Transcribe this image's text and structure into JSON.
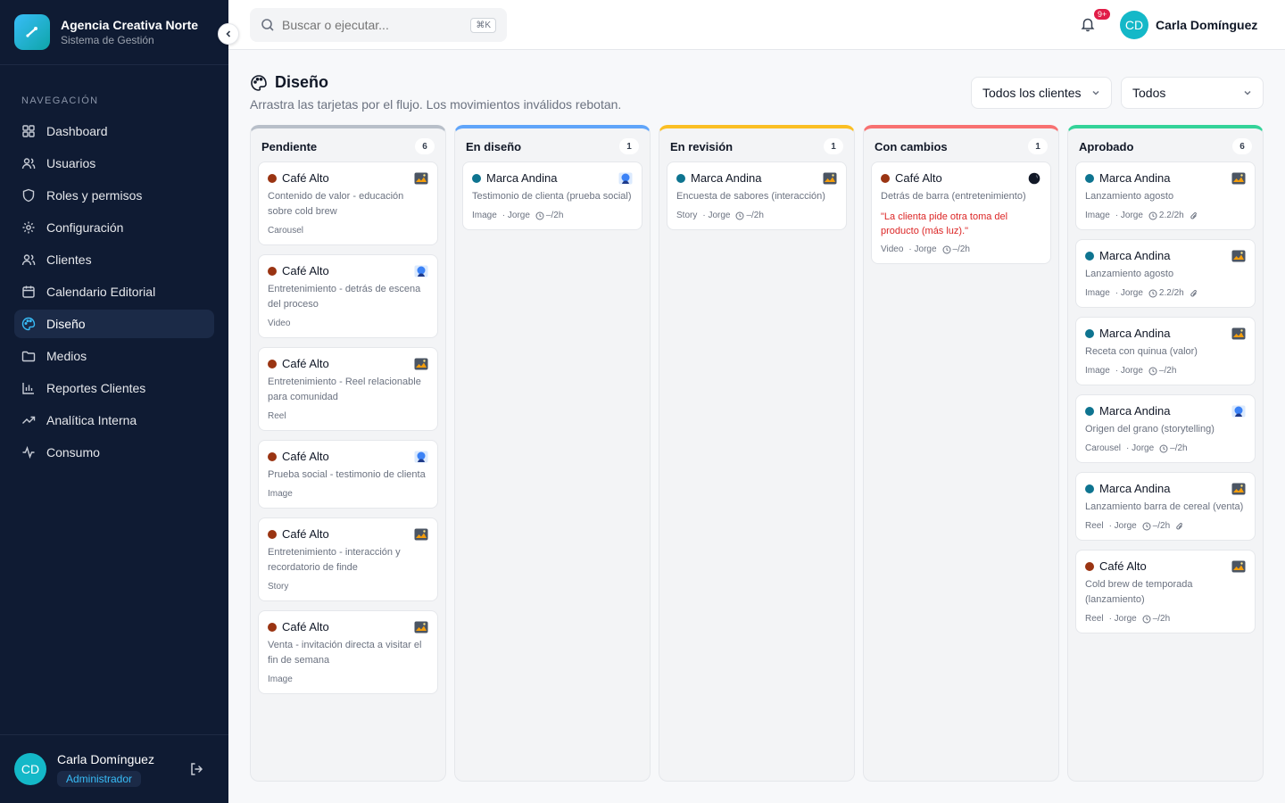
{
  "brand": {
    "title": "Agencia Creativa Norte",
    "subtitle": "Sistema de Gestión"
  },
  "nav": {
    "heading": "NAVEGACIÓN",
    "items": [
      {
        "label": "Dashboard",
        "icon": "grid-icon"
      },
      {
        "label": "Usuarios",
        "icon": "users-icon"
      },
      {
        "label": "Roles y permisos",
        "icon": "shield-icon"
      },
      {
        "label": "Configuración",
        "icon": "gear-icon"
      },
      {
        "label": "Clientes",
        "icon": "users-icon"
      },
      {
        "label": "Calendario Editorial",
        "icon": "calendar-icon"
      },
      {
        "label": "Diseño",
        "icon": "palette-icon",
        "active": true
      },
      {
        "label": "Medios",
        "icon": "folder-icon"
      },
      {
        "label": "Reportes Clientes",
        "icon": "bar-chart-icon"
      },
      {
        "label": "Analítica Interna",
        "icon": "trending-icon"
      },
      {
        "label": "Consumo",
        "icon": "activity-icon"
      }
    ]
  },
  "user": {
    "initials": "CD",
    "name": "Carla Domínguez",
    "role": "Administrador"
  },
  "search": {
    "placeholder": "Buscar o ejecutar...",
    "shortcut": "⌘K"
  },
  "notifications": {
    "badge": "9+"
  },
  "page": {
    "title": "Diseño",
    "description": "Arrastra las tarjetas por el flujo. Los movimientos inválidos rebotan."
  },
  "filters": {
    "clients": "Todos los clientes",
    "status": "Todos"
  },
  "colors": {
    "cafe": "#9a3412",
    "marca": "#0e7490",
    "accent": "#38bdf8"
  },
  "columns": [
    {
      "title": "Pendiente",
      "count": "6",
      "color": "#b8bfc9",
      "cards": [
        {
          "client": "Café Alto",
          "dot": "#9a3412",
          "thumb": "landscape",
          "desc": "Contenido de valor - educación sobre cold brew",
          "meta": [
            "Carousel"
          ]
        },
        {
          "client": "Café Alto",
          "dot": "#9a3412",
          "thumb": "portrait",
          "desc": "Entretenimiento - detrás de escena del proceso",
          "meta": [
            "Video"
          ]
        },
        {
          "client": "Café Alto",
          "dot": "#9a3412",
          "thumb": "landscape",
          "desc": "Entretenimiento - Reel relacionable para comunidad",
          "meta": [
            "Reel"
          ]
        },
        {
          "client": "Café Alto",
          "dot": "#9a3412",
          "thumb": "portrait",
          "desc": "Prueba social - testimonio de clienta",
          "meta": [
            "Image"
          ]
        },
        {
          "client": "Café Alto",
          "dot": "#9a3412",
          "thumb": "landscape",
          "desc": "Entretenimiento - interacción y recordatorio de finde",
          "meta": [
            "Story"
          ]
        },
        {
          "client": "Café Alto",
          "dot": "#9a3412",
          "thumb": "landscape",
          "desc": "Venta - invitación directa a visitar el fin de semana",
          "meta": [
            "Image"
          ]
        }
      ]
    },
    {
      "title": "En diseño",
      "count": "1",
      "color": "#60a5fa",
      "cards": [
        {
          "client": "Marca Andina",
          "dot": "#0e7490",
          "thumb": "portrait",
          "desc": "Testimonio de clienta (prueba social)",
          "meta": [
            "Image",
            "· Jorge"
          ],
          "time": "–/2h"
        }
      ]
    },
    {
      "title": "En revisión",
      "count": "1",
      "color": "#fbbf24",
      "cards": [
        {
          "client": "Marca Andina",
          "dot": "#0e7490",
          "thumb": "landscape",
          "desc": "Encuesta de sabores (interacción)",
          "meta": [
            "Story",
            "· Jorge"
          ],
          "time": "–/2h"
        }
      ]
    },
    {
      "title": "Con cambios",
      "count": "1",
      "color": "#f87171",
      "cards": [
        {
          "client": "Café Alto",
          "dot": "#9a3412",
          "thumb": "dark",
          "desc": "Detrás de barra (entretenimiento)",
          "note": "\"La clienta pide otra toma del producto (más luz).\"",
          "meta": [
            "Video",
            "· Jorge"
          ],
          "time": "–/2h"
        }
      ]
    },
    {
      "title": "Aprobado",
      "count": "6",
      "color": "#34d399",
      "cards": [
        {
          "client": "Marca Andina",
          "dot": "#0e7490",
          "thumb": "landscape",
          "desc": "Lanzamiento agosto",
          "meta": [
            "Image",
            "· Jorge"
          ],
          "time": "2.2/2h",
          "attach": true
        },
        {
          "client": "Marca Andina",
          "dot": "#0e7490",
          "thumb": "landscape",
          "desc": "Lanzamiento agosto",
          "meta": [
            "Image",
            "· Jorge"
          ],
          "time": "2.2/2h",
          "attach": true
        },
        {
          "client": "Marca Andina",
          "dot": "#0e7490",
          "thumb": "landscape",
          "desc": "Receta con quinua (valor)",
          "meta": [
            "Image",
            "· Jorge"
          ],
          "time": "–/2h"
        },
        {
          "client": "Marca Andina",
          "dot": "#0e7490",
          "thumb": "portrait",
          "desc": "Origen del grano (storytelling)",
          "meta": [
            "Carousel",
            "· Jorge"
          ],
          "time": "–/2h"
        },
        {
          "client": "Marca Andina",
          "dot": "#0e7490",
          "thumb": "landscape",
          "desc": "Lanzamiento barra de cereal (venta)",
          "meta": [
            "Reel",
            "· Jorge"
          ],
          "time": "–/2h",
          "attach": true
        },
        {
          "client": "Café Alto",
          "dot": "#9a3412",
          "thumb": "landscape",
          "desc": "Cold brew de temporada (lanzamiento)",
          "meta": [
            "Reel",
            "· Jorge"
          ],
          "time": "–/2h"
        }
      ]
    }
  ]
}
